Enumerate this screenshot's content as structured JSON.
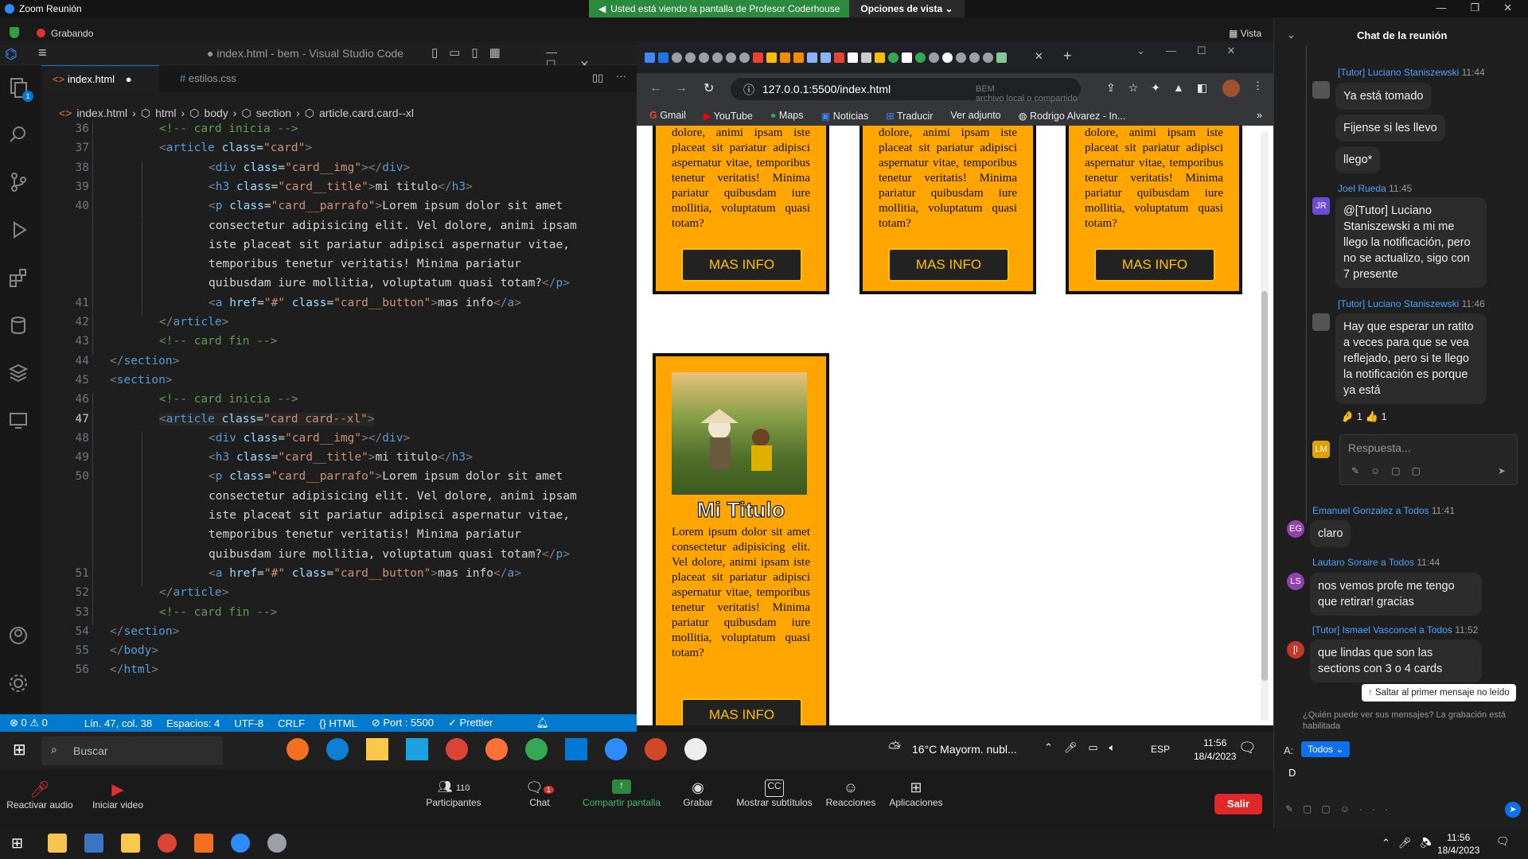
{
  "zoom": {
    "window_title": "Zoom Reunión",
    "share_banner": "Usted está viendo la pantalla de Profesor Coderhouse",
    "view_options": "Opciones de vista",
    "recording": "Grabando",
    "view": "Vista",
    "controls": {
      "mute": "Reactivar audio",
      "video": "Iniciar video",
      "participants": "Participantes",
      "participants_count": "110",
      "chat": "Chat",
      "chat_badge": "1",
      "share": "Compartir pantalla",
      "record": "Grabar",
      "subtitles": "Mostrar subtítulos",
      "reactions": "Reacciones",
      "apps": "Aplicaciones",
      "leave": "Salir"
    }
  },
  "vscode": {
    "title": "● index.html - bem - Visual Studio Code",
    "tabs": [
      {
        "label": "index.html",
        "modified": "●"
      },
      {
        "label": "estilos.css"
      }
    ],
    "breadcrumb": [
      "index.html",
      "html",
      "body",
      "section",
      "article.card.card--xl"
    ],
    "lines": [
      {
        "n": "36",
        "html": "<span class='c'>&lt;!-- card inicia --&gt;</span>",
        "indent": 1
      },
      {
        "n": "37",
        "html": "<span class='p'>&lt;</span><span class='t'>article</span> <span class='a'>class</span>=<span class='s'>\"card\"</span><span class='p'>&gt;</span>",
        "indent": 1
      },
      {
        "n": "38",
        "html": "<span class='p'>&lt;</span><span class='t'>div</span> <span class='a'>class</span>=<span class='s'>\"card__img\"</span><span class='p'>&gt;&lt;/</span><span class='t'>div</span><span class='p'>&gt;</span>",
        "indent": 2
      },
      {
        "n": "39",
        "html": "<span class='p'>&lt;</span><span class='t'>h3</span> <span class='a'>class</span>=<span class='s'>\"card__title\"</span><span class='p'>&gt;</span>mi titulo<span class='p'>&lt;/</span><span class='t'>h3</span><span class='p'>&gt;</span>",
        "indent": 2
      },
      {
        "n": "40",
        "html": "<span class='p'>&lt;</span><span class='t'>p</span> <span class='a'>class</span>=<span class='s'>\"card__parrafo\"</span><span class='p'>&gt;</span>Lorem ipsum dolor sit amet",
        "indent": 2
      },
      {
        "n": "",
        "html": "consectetur adipisicing elit. Vel dolore, animi ipsam",
        "indent": 2
      },
      {
        "n": "",
        "html": "iste placeat sit pariatur adipisci aspernatur vitae,",
        "indent": 2
      },
      {
        "n": "",
        "html": "temporibus tenetur veritatis! Minima pariatur",
        "indent": 2
      },
      {
        "n": "",
        "html": "quibusdam iure mollitia, voluptatum quasi totam?<span class='p'>&lt;/</span><span class='t'>p</span><span class='p'>&gt;</span>",
        "indent": 2
      },
      {
        "n": "41",
        "html": "<span class='p'>&lt;</span><span class='t'>a</span> <span class='a'>href</span>=<span class='s'>\"#\"</span> <span class='a'>class</span>=<span class='s'>\"card__button\"</span><span class='p'>&gt;</span>mas info<span class='p'>&lt;/</span><span class='t'>a</span><span class='p'>&gt;</span>",
        "indent": 2
      },
      {
        "n": "42",
        "html": "<span class='p'>&lt;/</span><span class='t'>article</span><span class='p'>&gt;</span>",
        "indent": 1
      },
      {
        "n": "43",
        "html": "<span class='c'>&lt;!-- card fin --&gt;</span>",
        "indent": 1
      },
      {
        "n": "44",
        "html": "<span class='p'>&lt;/</span><span class='t'>section</span><span class='p'>&gt;</span>",
        "indent": 0
      },
      {
        "n": "45",
        "html": "<span class='p'>&lt;</span><span class='t'>section</span><span class='p'>&gt;</span>",
        "indent": 0
      },
      {
        "n": "46",
        "html": "<span class='c'>&lt;!-- card inicia --&gt;</span>",
        "indent": 1
      },
      {
        "n": "47",
        "html": "<span class='p'>&lt;</span><span class='t'>article</span> <span class='a'>class</span>=<span class='s'>\"card card--xl\"</span><span class='p'>&gt;</span>",
        "indent": 1
      },
      {
        "n": "48",
        "html": "<span class='p'>&lt;</span><span class='t'>div</span> <span class='a'>class</span>=<span class='s'>\"card__img\"</span><span class='p'>&gt;&lt;/</span><span class='t'>div</span><span class='p'>&gt;</span>",
        "indent": 2
      },
      {
        "n": "49",
        "html": "<span class='p'>&lt;</span><span class='t'>h3</span> <span class='a'>class</span>=<span class='s'>\"card__title\"</span><span class='p'>&gt;</span>mi titulo<span class='p'>&lt;/</span><span class='t'>h3</span><span class='p'>&gt;</span>",
        "indent": 2
      },
      {
        "n": "50",
        "html": "<span class='p'>&lt;</span><span class='t'>p</span> <span class='a'>class</span>=<span class='s'>\"card__parrafo\"</span><span class='p'>&gt;</span>Lorem ipsum dolor sit amet",
        "indent": 2
      },
      {
        "n": "",
        "html": "consectetur adipisicing elit. Vel dolore, animi ipsam",
        "indent": 2
      },
      {
        "n": "",
        "html": "iste placeat sit pariatur adipisci aspernatur vitae,",
        "indent": 2
      },
      {
        "n": "",
        "html": "temporibus tenetur veritatis! Minima pariatur",
        "indent": 2
      },
      {
        "n": "",
        "html": "quibusdam iure mollitia, voluptatum quasi totam?<span class='p'>&lt;/</span><span class='t'>p</span><span class='p'>&gt;</span>",
        "indent": 2
      },
      {
        "n": "51",
        "html": "<span class='p'>&lt;</span><span class='t'>a</span> <span class='a'>href</span>=<span class='s'>\"#\"</span> <span class='a'>class</span>=<span class='s'>\"card__button\"</span><span class='p'>&gt;</span>mas info<span class='p'>&lt;/</span><span class='t'>a</span><span class='p'>&gt;</span>",
        "indent": 2
      },
      {
        "n": "52",
        "html": "<span class='p'>&lt;/</span><span class='t'>article</span><span class='p'>&gt;</span>",
        "indent": 1
      },
      {
        "n": "53",
        "html": "<span class='c'>&lt;!-- card fin --&gt;</span>",
        "indent": 1
      },
      {
        "n": "54",
        "html": "<span class='p'>&lt;/</span><span class='t'>section</span><span class='p'>&gt;</span>",
        "indent": 0
      },
      {
        "n": "55",
        "html": "<span class='p'>&lt;/</span><span class='t'>body</span><span class='p'>&gt;</span>",
        "indent": 0
      },
      {
        "n": "56",
        "html": "<span class='p'>&lt;/</span><span class='t'>html</span><span class='p'>&gt;</span>",
        "indent": 0
      }
    ],
    "status": {
      "problems": "⊗ 0 ⚠ 0",
      "position": "Lín. 47, col. 38",
      "spaces": "Espacios: 4",
      "encoding": "UTF-8",
      "eol": "CRLF",
      "language": "HTML",
      "port": "Port : 5500",
      "prettier": "Prettier"
    }
  },
  "taskbar": {
    "search": "Buscar",
    "weather": "16°C  Mayorm. nubl...",
    "lang": "ESP",
    "time": "11:56",
    "date": "18/4/2023"
  },
  "browser": {
    "url": "127.0.0.1:5500/index.html",
    "overlay_label": "BEM",
    "overlay_sub": "archivo local o compartido",
    "bookmarks": [
      "Gmail",
      "YouTube",
      "Maps",
      "Noticias",
      "Traducir",
      "Ver adjunto",
      "Rodrigo Alvarez - In..."
    ],
    "card_text_top": "dolore, animi ipsam iste placeat sit pariatur adipisci aspernatur vitae, temporibus tenetur veritatis! Minima pariatur quibusdam iure mollitia, voluptatum quasi totam?",
    "card_button": "MAS INFO",
    "card_title": "Mi Titulo",
    "card_text_full": "Lorem ipsum dolor sit amet consectetur adipisicing elit. Vel dolore, animi ipsam iste placeat sit pariatur adipisci aspernatur vitae, temporibus tenetur veritatis! Minima pariatur quibusdam iure mollitia, voluptatum quasi totam?"
  },
  "chat": {
    "title": "Chat de la reunión",
    "messages": [
      {
        "sender": "[Tutor] Luciano Staniszewski",
        "time": "11:44"
      },
      {
        "text": "Ya está tomado"
      },
      {
        "text": "Fijense si les llevo"
      },
      {
        "text": "llego*"
      },
      {
        "sender": "Joel Rueda",
        "time": "11:45",
        "initials": "JR"
      },
      {
        "text": "@[Tutor] Luciano Staniszewski a mi me llego la notificación, pero no se actualizo, sigo con 7 presente"
      },
      {
        "sender": "[Tutor] Luciano Staniszewski",
        "time": "11:46"
      },
      {
        "text": "Hay que esperar un ratito a veces para que se vea reflejado, pero si te llego la notificación es porque ya está"
      },
      {
        "reactions": "🤌 1   👍 1"
      },
      {
        "placeholder": "Respuesta..."
      },
      {
        "sender": "Emanuel Gonzalez a Todos",
        "time": "11:41",
        "initials": "EG"
      },
      {
        "text": "claro"
      },
      {
        "sender": "Lautaro Soraire a Todos",
        "time": "11:44",
        "initials": "LS"
      },
      {
        "text": "nos vemos profe me tengo que retirar! gracias"
      },
      {
        "sender": "[Tutor] Ismael Vasconcel a Todos",
        "time": "11:52",
        "initials": "[I"
      },
      {
        "text": "que lindas que son las sections con 3 o 4 cards"
      }
    ],
    "jump_unread": "Saltar al primer mensaje no leído",
    "privacy": "¿Quién puede ver sus mensajes? La grabación está habilitada",
    "to_label": "A:",
    "to_value": "Todos",
    "draft": "D",
    "reply_initials": "LM"
  },
  "os": {
    "time": "11:56",
    "date": "18/4/2023"
  }
}
